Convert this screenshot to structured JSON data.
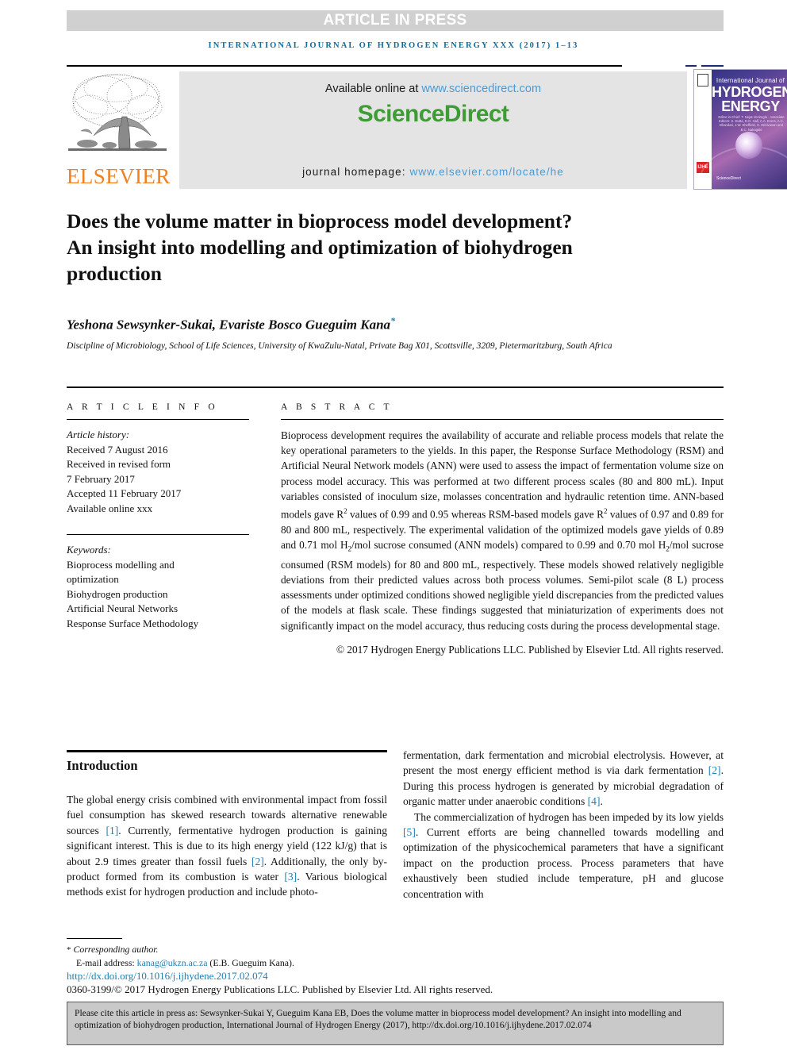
{
  "banner": {
    "article_in_press": "ARTICLE IN PRESS",
    "running_head": "INTERNATIONAL JOURNAL OF HYDROGEN ENERGY XXX (2017) 1–13"
  },
  "masthead": {
    "publisher_name": "ELSEVIER",
    "available_online_prefix": "Available online at ",
    "sciencedirect_url": "www.sciencedirect.com",
    "sciencedirect_logo_part1": "Science",
    "sciencedirect_logo_part2": "Direct",
    "journal_homepage_label": "journal homepage: ",
    "journal_homepage_url": "www.elsevier.com/locate/he",
    "cover": {
      "line_international": "International Journal of",
      "line_hydrogen": "HYDROGEN",
      "line_energy": "ENERGY",
      "editors": "Editor-in-Chief: T. Nejat Veziroglu · Associate Editors: S. Dutta, D.O. Hall, A.A. Evers, A.C. Bhandari, J.W. Sheffield, S. Srinivasan and B.C. Nakagaki",
      "mark_ijhe": "IJHE",
      "sciencedirect_mark": "ScienceDirect"
    }
  },
  "article": {
    "title": "Does the volume matter in bioprocess model development? An insight into modelling and optimization of biohydrogen production",
    "authors": "Yeshona Sewsynker-Sukai, Evariste Bosco Gueguim Kana",
    "corresponding_marker": "*",
    "affiliation": "Discipline of Microbiology, School of Life Sciences, University of KwaZulu-Natal, Private Bag X01, Scottsville, 3209, Pietermaritzburg, South Africa"
  },
  "article_info": {
    "heading": "A R T I C L E   I N F O",
    "history_label": "Article history:",
    "history": [
      "Received 7 August 2016",
      "Received in revised form",
      "7 February 2017",
      "Accepted 11 February 2017",
      "Available online xxx"
    ],
    "keywords_label": "Keywords:",
    "keywords": [
      "Bioprocess modelling and",
      "optimization",
      "Biohydrogen production",
      "Artificial Neural Networks",
      "Response Surface Methodology"
    ]
  },
  "abstract": {
    "heading": "A B S T R A C T",
    "paragraph_1": "Bioprocess development requires the availability of accurate and reliable process models that relate the key operational parameters to the yields. In this paper, the Response Surface Methodology (RSM) and Artificial Neural Network models (ANN) were used to assess the impact of fermentation volume size on process model accuracy. This was performed at two different process scales (80 and 800 mL). Input variables consisted of inoculum size, molasses concentration and hydraulic retention time. ANN-based models gave R",
    "r2_sup_1": "2",
    "paragraph_1b": " values of 0.99 and 0.95 whereas RSM-based models gave R",
    "r2_sup_2": "2",
    "paragraph_1c": " values of 0.97 and 0.89 for 80 and 800 mL, respectively. The experimental validation of the optimized models gave yields of 0.89 and 0.71 mol H",
    "h2_sub_1": "2",
    "paragraph_1d": "/mol sucrose consumed (ANN models) compared to 0.99 and 0.70 mol H",
    "h2_sub_2": "2",
    "paragraph_1e": "/mol sucrose consumed (RSM models) for 80 and 800 mL, respectively. These models showed relatively negligible deviations from their predicted values across both process volumes. Semi-pilot scale (8 L) process assessments under optimized conditions showed negligible yield discrepancies from the predicted values of the models at flask scale. These findings suggested that miniaturization of experiments does not significantly impact on the model accuracy, thus reducing costs during the process developmental stage.",
    "copyright": "© 2017 Hydrogen Energy Publications LLC. Published by Elsevier Ltd. All rights reserved."
  },
  "introduction": {
    "heading": "Introduction",
    "left_p1_a": "The global energy crisis combined with environmental impact from fossil fuel consumption has skewed research towards alternative renewable sources ",
    "left_ref1": "[1]",
    "left_p1_b": ". Currently, fermentative hydrogen production is gaining significant interest. This is due to its high energy yield (122 kJ/g) that is about 2.9 times greater than fossil fuels ",
    "left_ref2": "[2]",
    "left_p1_c": ". Additionally, the only by-product formed from its combustion is water ",
    "left_ref3": "[3]",
    "left_p1_d": ". Various biological methods exist for hydrogen production and include photo-",
    "right_p1_a": "fermentation, dark fermentation and microbial electrolysis. However, at present the most energy efficient method is via dark fermentation ",
    "right_ref2": "[2]",
    "right_p1_b": ". During this process hydrogen is generated by microbial degradation of organic matter under anaerobic conditions ",
    "right_ref4": "[4]",
    "right_p1_c": ".",
    "right_p2_a": "The commercialization of hydrogen has been impeded by its low yields ",
    "right_ref5": "[5]",
    "right_p2_b": ". Current efforts are being channelled towards modelling and optimization of the physicochemical parameters that have a significant impact on the production process. Process parameters that have exhaustively been studied include temperature, pH and glucose concentration with"
  },
  "footer": {
    "corresponding_marker": "*",
    "corresponding_label": "Corresponding author.",
    "email_label": "E-mail address: ",
    "email": "kanag@ukzn.ac.za",
    "email_suffix": " (E.B. Gueguim Kana).",
    "doi": "http://dx.doi.org/10.1016/j.ijhydene.2017.02.074",
    "issn_line": "0360-3199/© 2017 Hydrogen Energy Publications LLC. Published by Elsevier Ltd. All rights reserved."
  },
  "citation_box": {
    "text": "Please cite this article in press as: Sewsynker-Sukai Y, Gueguim Kana EB, Does the volume matter in bioprocess model development? An insight into modelling and optimization of biohydrogen production, International Journal of Hydrogen Energy (2017), http://dx.doi.org/10.1016/j.ijhydene.2017.02.074"
  },
  "colors": {
    "accent_blue": "#1a7fb5",
    "link_blue": "#4a9bd4",
    "sciencedirect_green": "#3f9c35",
    "elsevier_orange": "#f08020",
    "banner_grey": "#d0d0d0",
    "band_grey": "#e4e4e4",
    "cite_box_grey": "#c9c9c9"
  }
}
